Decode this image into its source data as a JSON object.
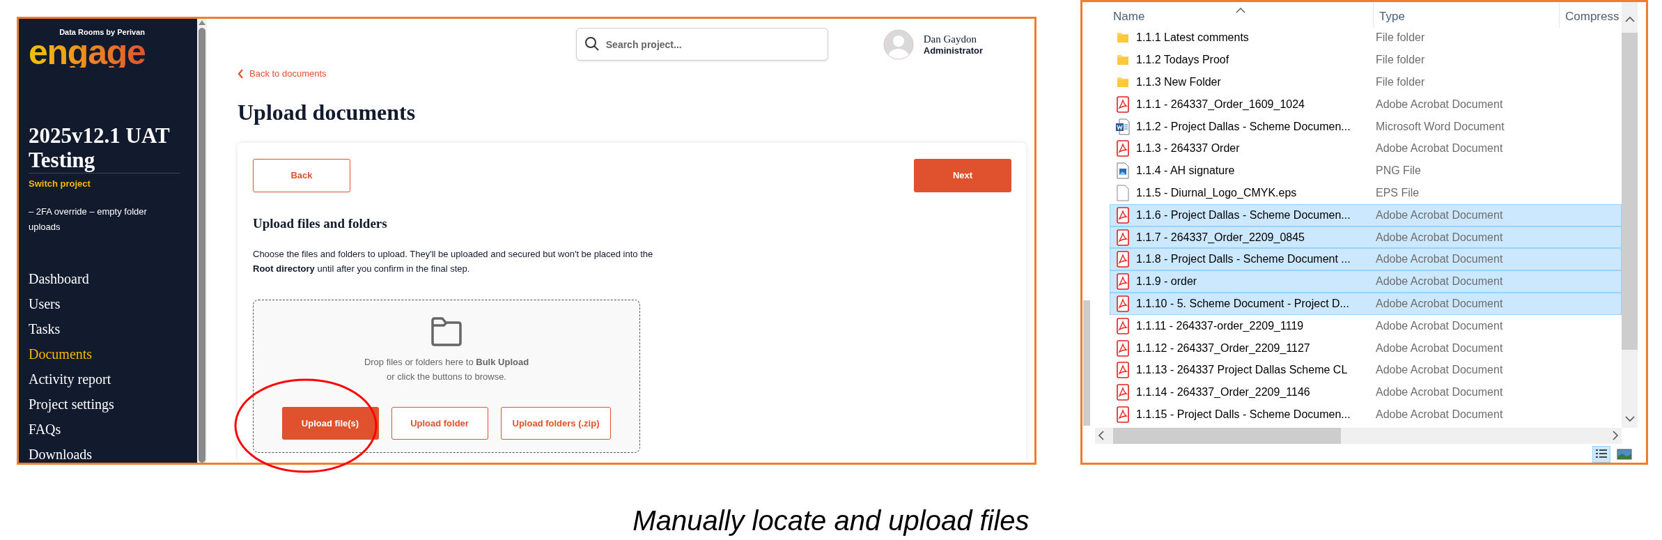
{
  "web_app": {
    "sidebar": {
      "tagline": "Data Rooms by Perivan",
      "logo": "engage",
      "project_title": "2025v12.1 UAT Testing",
      "switch_link": "Switch project",
      "description": "– 2FA override – empty folder uploads",
      "nav": [
        {
          "label": "Dashboard",
          "selected": false
        },
        {
          "label": "Users",
          "selected": false
        },
        {
          "label": "Tasks",
          "selected": false
        },
        {
          "label": "Documents",
          "selected": true
        },
        {
          "label": "Activity report",
          "selected": false
        },
        {
          "label": "Project settings",
          "selected": false
        },
        {
          "label": "FAQs",
          "selected": false
        },
        {
          "label": "Downloads",
          "selected": false
        }
      ]
    },
    "header": {
      "search_placeholder": "Search project...",
      "user_name": "Dan Gaydon",
      "user_role": "Administrator"
    },
    "back_link": "Back to documents",
    "page_title": "Upload documents",
    "card": {
      "nav_buttons": [
        {
          "label": "Back",
          "kind": "outline"
        },
        {
          "label": "Next",
          "kind": "filled"
        }
      ],
      "section_title": "Upload files and folders",
      "paragraph": "Choose the files and folders to upload. They'll be uploaded and secured but won't be placed into the **Root directory** until after you confirm in the final step.",
      "dropzone": {
        "line_1": "Drop files or folders here to **Bulk Upload**",
        "line_2": "or click the buttons to browse."
      },
      "upload_buttons": [
        {
          "label": "Upload file(s)",
          "kind": "filled"
        },
        {
          "label": "Upload folder",
          "kind": "outline"
        },
        {
          "label": "Upload folders (.zip)",
          "kind": "outline"
        }
      ]
    }
  },
  "file_explorer": {
    "columns": [
      "Name",
      "Type",
      "Compress"
    ],
    "files": [
      {
        "name": "1.1.1 Latest comments",
        "type": "File folder",
        "kind": "folder",
        "selected": false
      },
      {
        "name": "1.1.2 Todays Proof",
        "type": "File folder",
        "kind": "folder",
        "selected": false
      },
      {
        "name": "1.1.3 New Folder",
        "type": "File folder",
        "kind": "folder",
        "selected": false
      },
      {
        "name": "1.1.1 - 264337_Order_1609_1024",
        "type": "Adobe Acrobat Document",
        "kind": "pdf",
        "selected": false
      },
      {
        "name": "1.1.2 - Project Dallas - Scheme Documen...",
        "type": "Microsoft Word Document",
        "kind": "word",
        "selected": false
      },
      {
        "name": "1.1.3 - 264337 Order",
        "type": "Adobe Acrobat Document",
        "kind": "pdf",
        "selected": false
      },
      {
        "name": "1.1.4 - AH signature",
        "type": "PNG File",
        "kind": "image",
        "selected": false
      },
      {
        "name": "1.1.5 - Diurnal_Logo_CMYK.eps",
        "type": "EPS File",
        "kind": "blank",
        "selected": false
      },
      {
        "name": "1.1.6 - Project Dallas - Scheme Documen...",
        "type": "Adobe Acrobat Document",
        "kind": "pdf",
        "selected": true
      },
      {
        "name": "1.1.7 - 264337_Order_2209_0845",
        "type": "Adobe Acrobat Document",
        "kind": "pdf",
        "selected": true
      },
      {
        "name": "1.1.8 - Project Dalls - Scheme Document ...",
        "type": "Adobe Acrobat Document",
        "kind": "pdf",
        "selected": true
      },
      {
        "name": "1.1.9 - order",
        "type": "Adobe Acrobat Document",
        "kind": "pdf",
        "selected": true
      },
      {
        "name": "1.1.10 - 5. Scheme Document - Project D...",
        "type": "Adobe Acrobat Document",
        "kind": "pdf",
        "selected": true
      },
      {
        "name": "1.1.11 - 264337-order_2209_1119",
        "type": "Adobe Acrobat Document",
        "kind": "pdf",
        "selected": false
      },
      {
        "name": "1.1.12 - 264337_Order_2209_1127",
        "type": "Adobe Acrobat Document",
        "kind": "pdf",
        "selected": false
      },
      {
        "name": "1.1.13 - 264337 Project Dallas Scheme CL",
        "type": "Adobe Acrobat Document",
        "kind": "pdf",
        "selected": false
      },
      {
        "name": "1.1.14 - 264337_Order_2209_1146",
        "type": "Adobe Acrobat Document",
        "kind": "pdf",
        "selected": false
      },
      {
        "name": "1.1.15 - Project Dalls - Scheme Documen...",
        "type": "Adobe Acrobat Document",
        "kind": "pdf",
        "selected": false
      }
    ]
  },
  "caption": "Manually locate and upload files"
}
